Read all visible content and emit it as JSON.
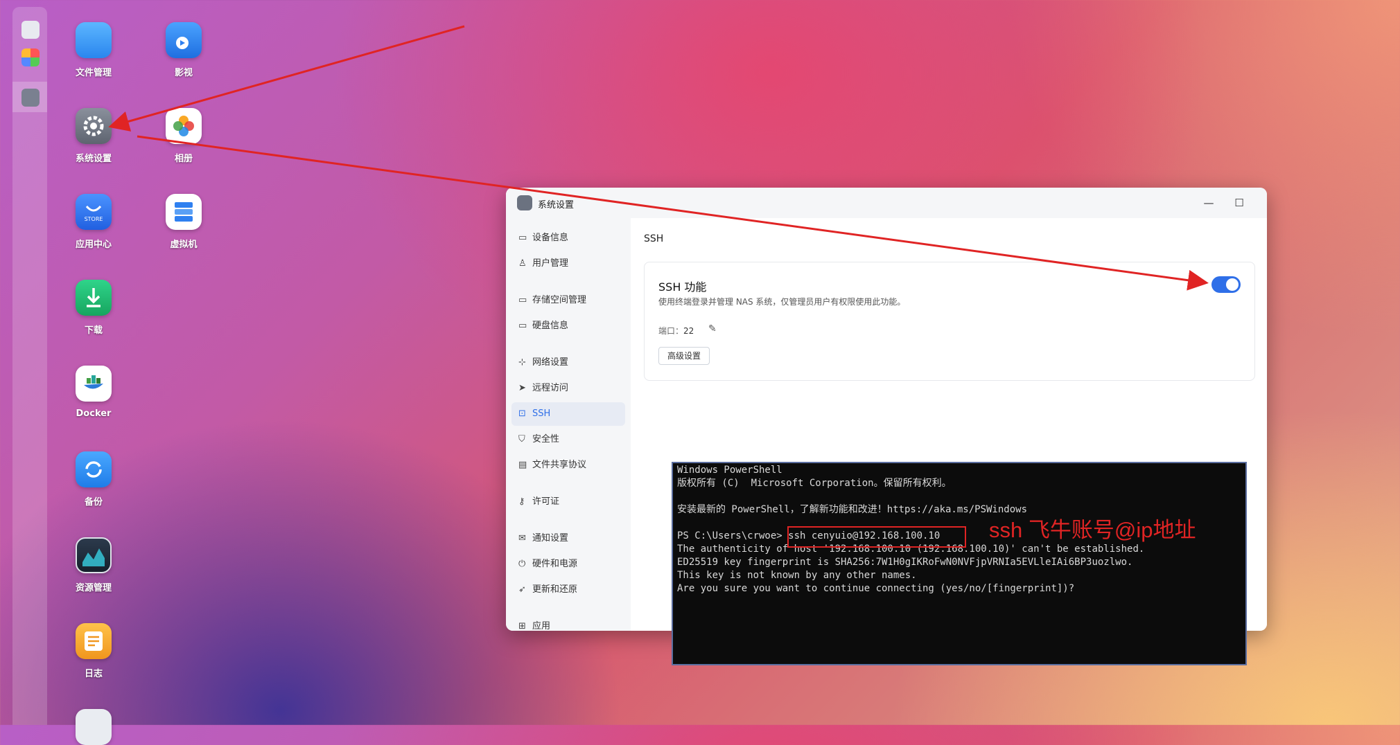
{
  "desktop": {
    "icons": [
      {
        "label": "文件管理",
        "icon": "folder-icon",
        "color": "#3b9af5"
      },
      {
        "label": "影视",
        "icon": "video-player-icon",
        "color": "#2f80f0"
      },
      {
        "label": "系统设置",
        "icon": "gear-icon",
        "color": "#7a808c"
      },
      {
        "label": "相册",
        "icon": "photos-icon",
        "color": "#ffffff"
      },
      {
        "label": "应用中心",
        "icon": "store-icon",
        "color": "#2f7bf0"
      },
      {
        "label": "虚拟机",
        "icon": "virtual-machine-icon",
        "color": "#ffffff"
      },
      {
        "label": "下载",
        "icon": "download-icon",
        "color": "#22b573"
      },
      {
        "label": "Docker",
        "icon": "docker-icon",
        "color": "#ffffff"
      },
      {
        "label": "备份",
        "icon": "backup-icon",
        "color": "#2f8cf0"
      },
      {
        "label": "资源管理",
        "icon": "resource-monitor-icon",
        "color": "#1f2b3a"
      },
      {
        "label": "日志",
        "icon": "log-icon",
        "color": "#f5a623"
      }
    ],
    "store_badge": "STORE"
  },
  "window": {
    "title": "系统设置",
    "controls": {
      "minimize": "—",
      "maximize": "☐",
      "close": "✕"
    },
    "sidebar": [
      {
        "label": "设备信息",
        "icon": "device-icon"
      },
      {
        "label": "用户管理",
        "icon": "users-icon"
      },
      {
        "label": "存储空间管理",
        "icon": "storage-icon"
      },
      {
        "label": "硬盘信息",
        "icon": "disk-icon"
      },
      {
        "label": "网络设置",
        "icon": "network-icon"
      },
      {
        "label": "远程访问",
        "icon": "remote-icon"
      },
      {
        "label": "SSH",
        "icon": "ssh-icon",
        "active": true
      },
      {
        "label": "安全性",
        "icon": "shield-icon"
      },
      {
        "label": "文件共享协议",
        "icon": "file-share-icon"
      },
      {
        "label": "许可证",
        "icon": "key-icon"
      },
      {
        "label": "通知设置",
        "icon": "mail-icon"
      },
      {
        "label": "硬件和电源",
        "icon": "power-icon"
      },
      {
        "label": "更新和还原",
        "icon": "rocket-icon"
      },
      {
        "label": "应用",
        "icon": "apps-icon"
      }
    ],
    "content": {
      "title": "SSH",
      "card": {
        "heading": "SSH 功能",
        "description": "使用终端登录并管理 NAS 系统，仅管理员用户有权限使用此功能。",
        "port_label": "端口：",
        "port_value": "22",
        "advanced_button": "高级设置",
        "ssh_enabled": true
      }
    }
  },
  "terminal": {
    "lines": [
      "Windows PowerShell",
      "版权所有 (C)  Microsoft Corporation。保留所有权利。",
      "",
      "安装最新的 PowerShell，了解新功能和改进！https://aka.ms/PSWindows",
      "",
      "PS C:\\Users\\crwoe> ssh cenyuio@192.168.100.10",
      "The authenticity of host '192.168.100.10 (192.168.100.10)' can't be established.",
      "ED25519 key fingerprint is SHA256:7W1H0gIKRoFwN0NVFjpVRNIa5EVLleIAi6BP3uozlwo.",
      "This key is not known by any other names.",
      "Are you sure you want to continue connecting (yes/no/[fingerprint])?"
    ]
  },
  "annotation": {
    "text": "ssh 飞牛账号@ip地址",
    "color": "#e02424"
  }
}
